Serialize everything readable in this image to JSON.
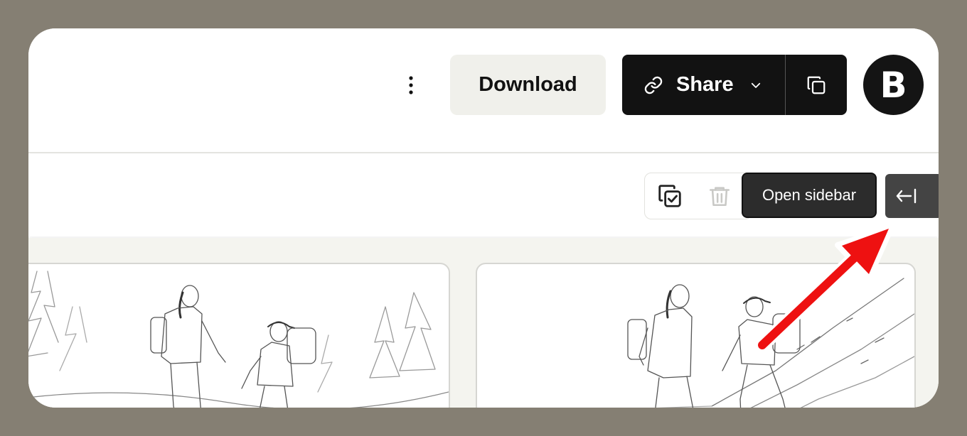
{
  "header": {
    "more_icon": "more-vertical-icon",
    "download_label": "Download",
    "share": {
      "label": "Share",
      "link_icon": "link-icon",
      "dropdown_icon": "chevron-down-icon",
      "copy_icon": "copy-icon"
    },
    "avatar_initial": "B"
  },
  "toolbar": {
    "select_icon": "select-all-icon",
    "delete_icon": "trash-icon",
    "tooltip": "Open sidebar",
    "sidebar_icon": "open-sidebar-icon"
  },
  "gallery": {
    "images": [
      {
        "subject": "pencil sketch of two hikers on a forest trail"
      },
      {
        "subject": "pencil sketch of two hikers climbing a rocky slope"
      }
    ]
  },
  "annotation": {
    "type": "red-arrow",
    "color": "#ee1111"
  },
  "colors": {
    "frame": "#857f73",
    "dark_button": "#121212",
    "download_bg": "#f0f0eb",
    "content_bg": "#f4f4ef"
  }
}
